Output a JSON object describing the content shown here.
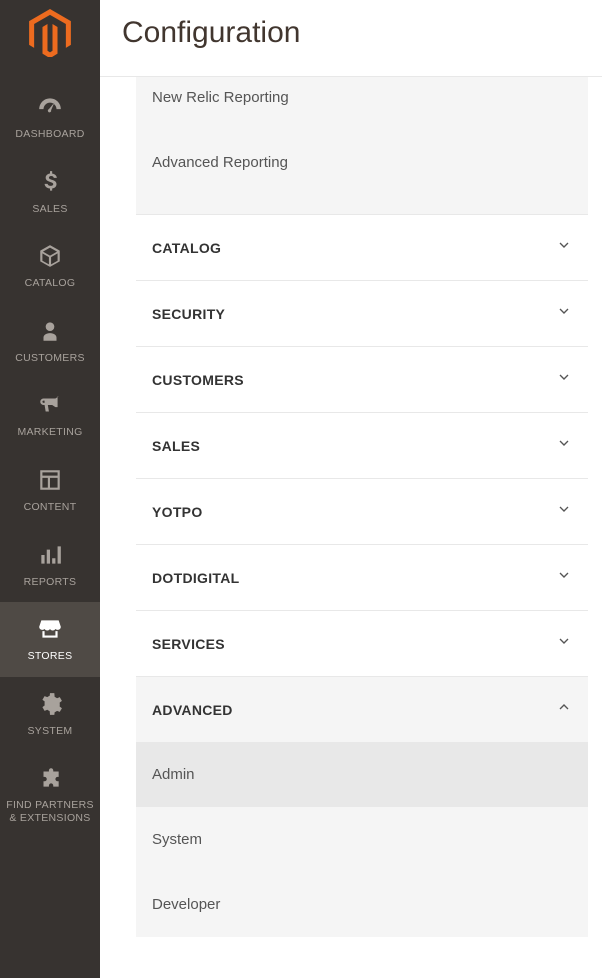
{
  "sidebar": {
    "items": [
      {
        "label": "DASHBOARD"
      },
      {
        "label": "SALES"
      },
      {
        "label": "CATALOG"
      },
      {
        "label": "CUSTOMERS"
      },
      {
        "label": "MARKETING"
      },
      {
        "label": "CONTENT"
      },
      {
        "label": "REPORTS"
      },
      {
        "label": "STORES"
      },
      {
        "label": "SYSTEM"
      },
      {
        "label": "FIND PARTNERS & EXTENSIONS"
      }
    ]
  },
  "header": {
    "title": "Configuration"
  },
  "top_sub_items": [
    {
      "label": "New Relic Reporting"
    },
    {
      "label": "Advanced Reporting"
    }
  ],
  "sections": [
    {
      "title": "CATALOG"
    },
    {
      "title": "SECURITY"
    },
    {
      "title": "CUSTOMERS"
    },
    {
      "title": "SALES"
    },
    {
      "title": "YOTPO"
    },
    {
      "title": "DOTDIGITAL"
    },
    {
      "title": "SERVICES"
    }
  ],
  "advanced": {
    "title": "ADVANCED",
    "items": [
      {
        "label": "Admin"
      },
      {
        "label": "System"
      },
      {
        "label": "Developer"
      }
    ]
  }
}
